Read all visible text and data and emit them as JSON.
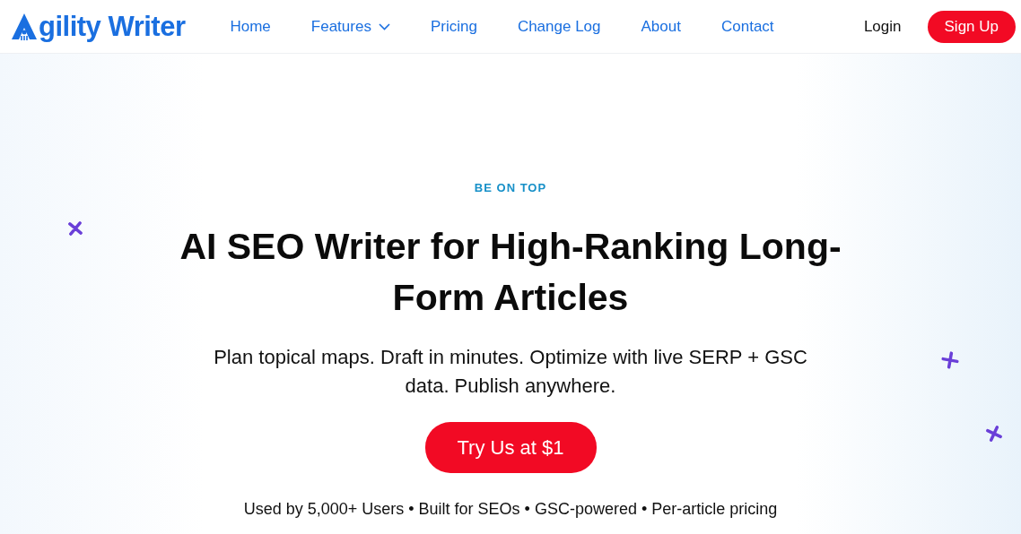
{
  "logo": {
    "text": "gility Writer"
  },
  "nav": [
    {
      "label": "Home",
      "dropdown": false
    },
    {
      "label": "Features",
      "dropdown": true
    },
    {
      "label": "Pricing",
      "dropdown": false
    },
    {
      "label": "Change Log",
      "dropdown": false
    },
    {
      "label": "About",
      "dropdown": false
    },
    {
      "label": "Contact",
      "dropdown": false
    }
  ],
  "login": "Login",
  "signup": "Sign Up",
  "hero": {
    "eyebrow": "BE ON TOP",
    "title": "AI SEO Writer for High-Ranking Long-Form Articles",
    "subtitle": "Plan topical maps. Draft in minutes. Optimize with live SERP + GSC data. Publish anywhere.",
    "cta": "Try Us at $1",
    "proof": "Used by 5,000+ Users • Built for SEOs • GSC-powered • Per-article pricing"
  }
}
